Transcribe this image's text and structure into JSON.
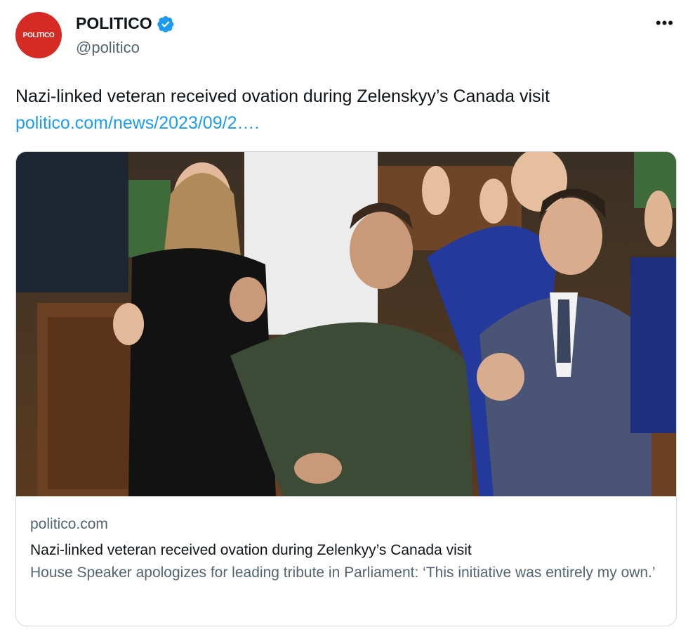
{
  "author": {
    "avatar_text": "POLITICO",
    "name": "POLITICO",
    "handle": "@politico",
    "verified": true
  },
  "more_icon": "more-horizontal-icon",
  "tweet": {
    "text": "Nazi-linked veteran received ovation during Zelenskyy’s Canada visit",
    "link": "politico.com/news/2023/09/2…."
  },
  "card": {
    "image_alt": "Photo of four people standing and applauding in a parliament chamber",
    "domain": "politico.com",
    "title": "Nazi-linked veteran received ovation during Zelenkyy’s Canada visit",
    "description": "House Speaker apologizes for leading tribute in Parliament: ‘This initiative was entirely my own.’"
  },
  "colors": {
    "accent": "#1d9bf0",
    "brand": "#d62b25",
    "secondary_text": "#536471"
  }
}
